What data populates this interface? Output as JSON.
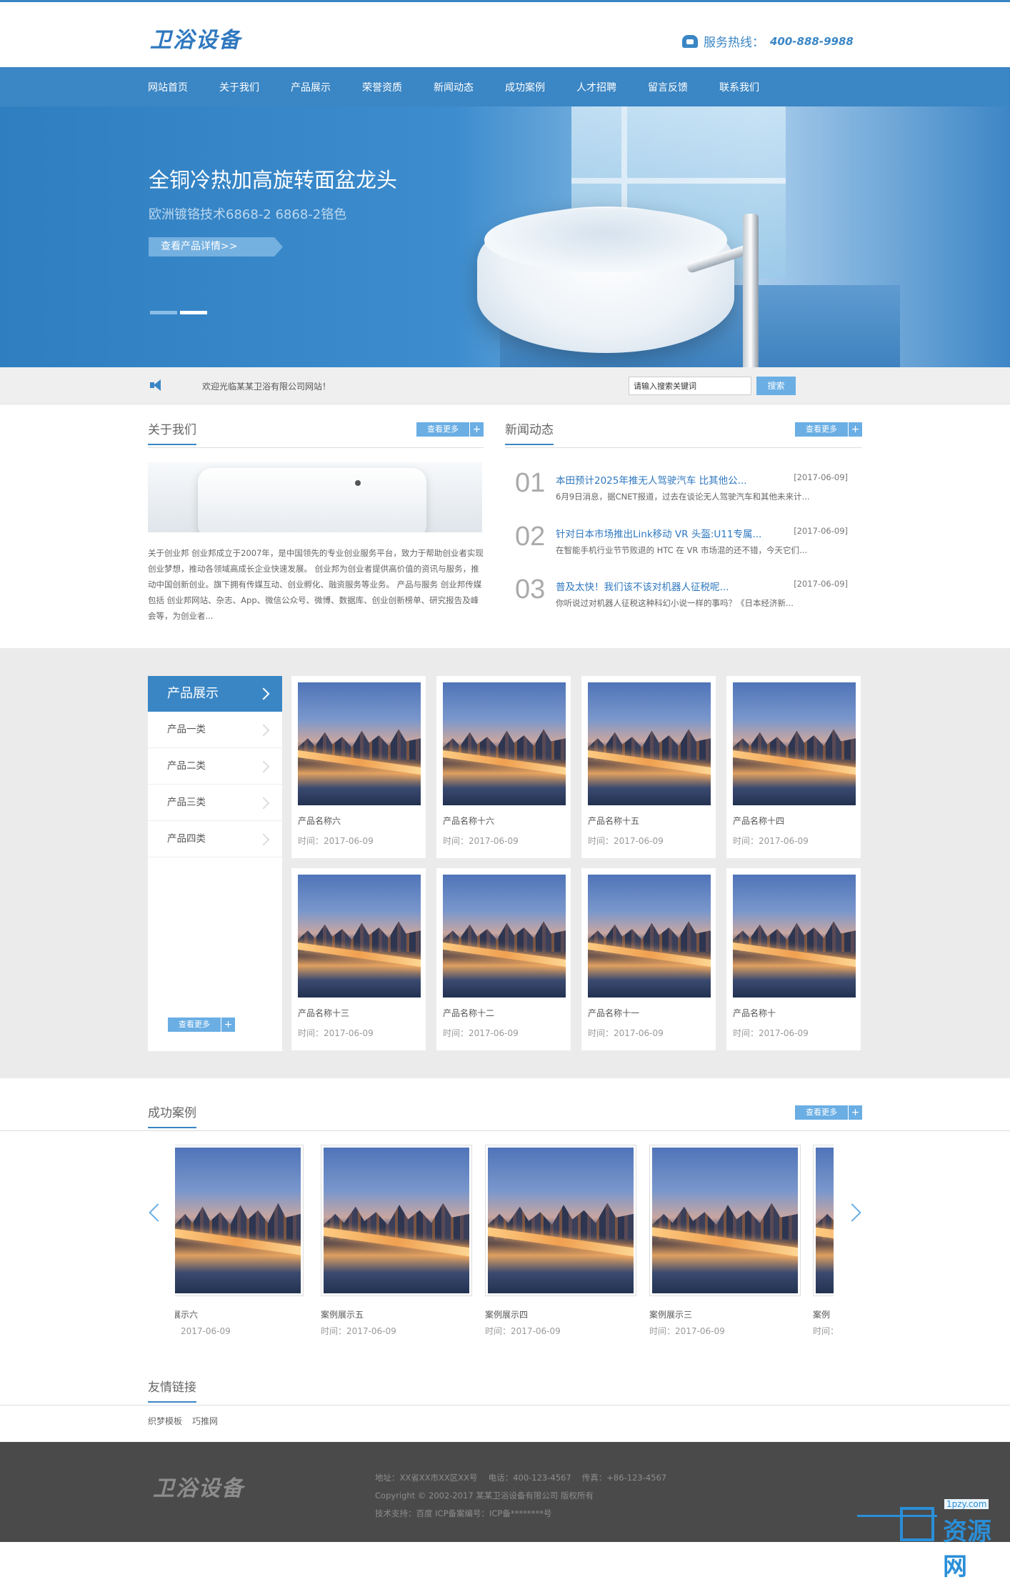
{
  "header": {
    "logo": "卫浴设备",
    "hotline_label": "服务热线：",
    "hotline_number": "400-888-9988",
    "accent_color": "#3a86c5"
  },
  "nav": [
    "网站首页",
    "关于我们",
    "产品展示",
    "荣誉资质",
    "新闻动态",
    "成功案例",
    "人才招聘",
    "留言反馈",
    "联系我们"
  ],
  "banner": {
    "title": "全铜冷热加高旋转面盆龙头",
    "subtitle": "欧洲镀铬技术6868-2 6868-2铬色",
    "button": "查看产品详情>>",
    "slides": 2,
    "active_slide": 2
  },
  "notice": {
    "welcome": "欢迎光临某某卫浴有限公司网站！",
    "search_value": "请输入搜索关键词",
    "search_button": "搜索"
  },
  "more_label": "查看更多",
  "about": {
    "title": "关于我们",
    "text": "关于创业邦 创业邦成立于2007年，是中国领先的专业创业服务平台，致力于帮助创业者实现创业梦想，推动各领域高成长企业快速发展。 创业邦为创业者提供高价值的资讯与服务，推动中国创新创业。旗下拥有传媒互动、创业孵化、融资服务等业务。 产品与服务 创业邦传媒 包括 创业邦网站、杂志、App、微信公众号、微博、数据库、创业创新榜单、研究报告及峰会等，为创业者..."
  },
  "news": {
    "title": "新闻动态",
    "items": [
      {
        "num": "01",
        "title": "本田预计2025年推无人驾驶汽车 比其他公...",
        "date": "[2017-06-09]",
        "summary": "6月9日消息，据CNET报道，过去在谈论无人驾驶汽车和其他未来计..."
      },
      {
        "num": "02",
        "title": "针对日本市场推出Link移动 VR 头盔:U11专属...",
        "date": "[2017-06-09]",
        "summary": "在智能手机行业节节败退的 HTC 在 VR 市场混的还不错，今天它们..."
      },
      {
        "num": "03",
        "title": "普及太快！我们该不该对机器人征税呢...",
        "date": "[2017-06-09]",
        "summary": "你听说过对机器人征税这种科幻小说一样的事吗？《日本经济新..."
      }
    ]
  },
  "products": {
    "title": "产品展示",
    "categories": [
      "产品一类",
      "产品二类",
      "产品三类",
      "产品四类"
    ],
    "items": [
      {
        "name": "产品名称六",
        "time": "时间：2017-06-09"
      },
      {
        "name": "产品名称十六",
        "time": "时间：2017-06-09"
      },
      {
        "name": "产品名称十五",
        "time": "时间：2017-06-09"
      },
      {
        "name": "产品名称十四",
        "time": "时间：2017-06-09"
      },
      {
        "name": "产品名称十三",
        "time": "时间：2017-06-09"
      },
      {
        "name": "产品名称十二",
        "time": "时间：2017-06-09"
      },
      {
        "name": "产品名称十一",
        "time": "时间：2017-06-09"
      },
      {
        "name": "产品名称十",
        "time": "时间：2017-06-09"
      }
    ]
  },
  "cases": {
    "title": "成功案例",
    "items": [
      {
        "name": "展示六",
        "time": "：2017-06-09"
      },
      {
        "name": "案例展示五",
        "time": "时间：2017-06-09"
      },
      {
        "name": "案例展示四",
        "time": "时间：2017-06-09"
      },
      {
        "name": "案例展示三",
        "time": "时间：2017-06-09"
      },
      {
        "name": "案例",
        "time": "时间："
      }
    ]
  },
  "links": {
    "title": "友情链接",
    "items": [
      "织梦模板",
      "巧推网"
    ]
  },
  "footer": {
    "logo": "卫浴设备",
    "address": "地址：XX省XX市XX区XX号　 电话：400-123-4567　 传真：+86-123-4567",
    "copyright": "Copyright © 2002-2017 某某卫浴设备有限公司 版权所有",
    "support": "技术支持：百度 ICP备案编号：ICP备********号"
  },
  "watermark": {
    "site": "1pzy.com",
    "name": "资源网"
  }
}
